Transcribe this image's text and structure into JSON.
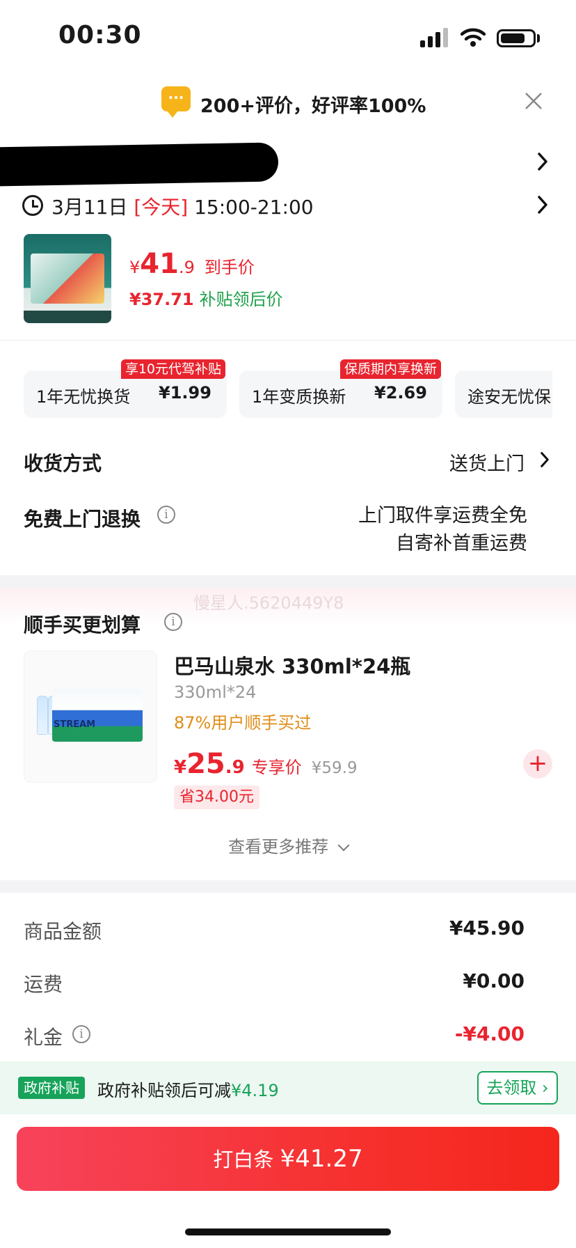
{
  "status_bar": {
    "time": "00:30"
  },
  "banner": {
    "icon": "chat-bubble-icon",
    "text": "200+评价，好评率100%"
  },
  "delivery": {
    "date_prefix": "3月11日 ",
    "today": "[今天]",
    "time_range": " 15:00-21:00"
  },
  "product": {
    "price_yen": "¥",
    "price_big": "41",
    "price_small": ".9",
    "price_tag": "到手价",
    "subsidy_price": "¥37.71",
    "subsidy_label": "补贴领后价"
  },
  "services": [
    {
      "label": "1年无忧换货",
      "price": "¥1.99",
      "badge": "享10元代驾补贴"
    },
    {
      "label": "1年变质换新",
      "price": "¥2.69",
      "badge": "保质期内享换新"
    },
    {
      "label": "途安无忧保",
      "price": "",
      "badge": ""
    }
  ],
  "shipping": {
    "title": "收货方式",
    "value": "送货上门"
  },
  "returns": {
    "title": "免费上门退换",
    "line1": "上门取件享运费全免",
    "line2": "自寄补首重运费"
  },
  "recommend": {
    "title": "顺手买更划算",
    "watermark": "慢星人.5620449Y8",
    "item": {
      "name": "巴马山泉水 330ml*24瓶",
      "spec": "330ml*24",
      "bought": "87%用户顺手买过",
      "price_yen": "¥",
      "price_big": "25",
      "price_small": ".9",
      "price_tag": "专享价",
      "orig_price": "¥59.9",
      "save": "省34.00元",
      "image_label": "STREAM"
    },
    "more": "查看更多推荐"
  },
  "summary": [
    {
      "label": "商品金额",
      "value": "¥45.90",
      "color": "#1a1a1a"
    },
    {
      "label": "运费",
      "value": "¥0.00",
      "color": "#1a1a1a"
    },
    {
      "label": "礼金",
      "value": "-¥4.00",
      "color": "#e8242f"
    }
  ],
  "gov": {
    "badge": "政府补贴",
    "text": "政府补贴领后可减",
    "amount": "¥4.19",
    "button": "去领取"
  },
  "pay": {
    "label": "打白条 ",
    "amount": "¥41.27"
  },
  "colors": {
    "accent_red": "#e8242f",
    "green": "#17a35a",
    "orange": "#e08d18"
  }
}
